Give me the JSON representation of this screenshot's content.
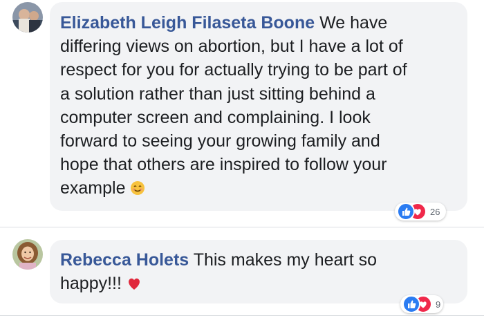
{
  "comments": [
    {
      "author": "Elizabeth Leigh Filaseta Boone",
      "lines": [
        " We have",
        "differing views on abortion, but I have a lot of",
        "respect for you for actually trying to be part of",
        "a solution rather than just sitting behind a",
        "computer screen and complaining. I look",
        "forward to seeing your growing family and",
        "hope that others are inspired to follow your",
        "example"
      ],
      "trailing_emoji": "smiling-face-icon",
      "reaction_count": "26"
    },
    {
      "author": "Rebecca Holets",
      "lines": [
        " This makes my heart so",
        "happy!!!"
      ],
      "trailing_emoji": "red-heart-icon",
      "reaction_count": "9"
    }
  ],
  "colors": {
    "author_link": "#385898",
    "bubble_bg": "#f2f3f5",
    "like_blue": "#2b7cf2",
    "love_red": "#f0284a"
  }
}
